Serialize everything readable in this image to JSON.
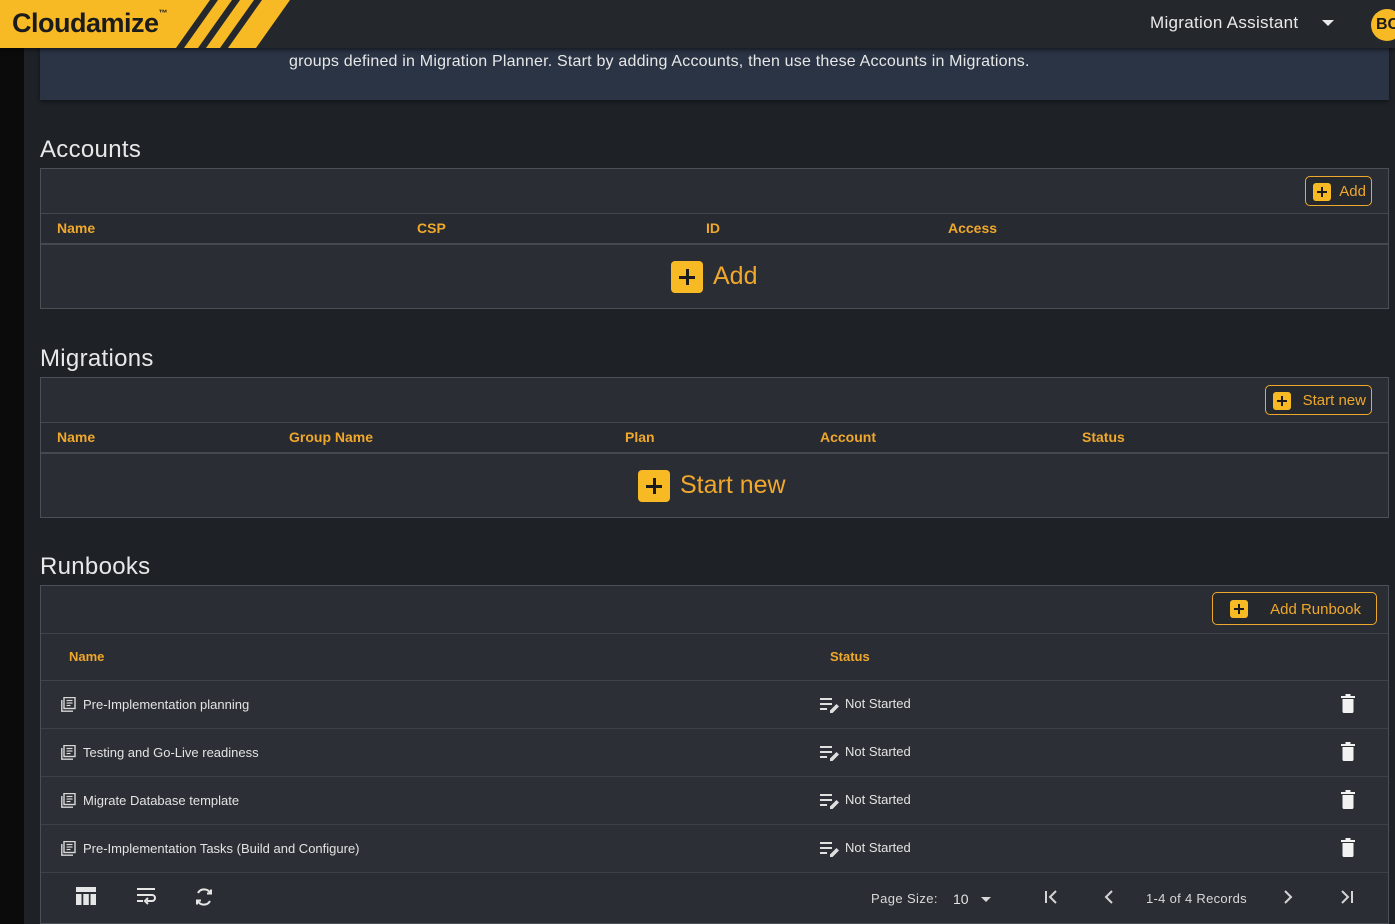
{
  "header": {
    "logo_text": "Cloudamize",
    "logo_tm": "™",
    "app_selector": "Migration Assistant",
    "avatar_initials": "BC",
    "accent_color": "#f7b924"
  },
  "banner": {
    "text": "groups defined in Migration Planner. Start by adding Accounts, then use these Accounts in Migrations."
  },
  "accounts": {
    "title": "Accounts",
    "add_label": "Add",
    "columns": [
      "Name",
      "CSP",
      "ID",
      "Access"
    ],
    "empty_add_label": "Add"
  },
  "migrations": {
    "title": "Migrations",
    "start_label": "Start new",
    "columns": [
      "Name",
      "Group Name",
      "Plan",
      "Account",
      "Status"
    ],
    "empty_start_label": "Start new"
  },
  "runbooks": {
    "title": "Runbooks",
    "add_label": "Add Runbook",
    "columns": [
      "Name",
      "Status"
    ],
    "rows": [
      {
        "name": "Pre-Implementation planning",
        "status": "Not Started"
      },
      {
        "name": "Testing and Go-Live readiness",
        "status": "Not Started"
      },
      {
        "name": "Migrate Database template",
        "status": "Not Started"
      },
      {
        "name": "Pre-Implementation Tasks (Build and Configure)",
        "status": "Not Started"
      }
    ],
    "footer": {
      "page_size_label": "Page Size:",
      "page_size": "10",
      "records": "1-4 of 4 Records"
    }
  }
}
